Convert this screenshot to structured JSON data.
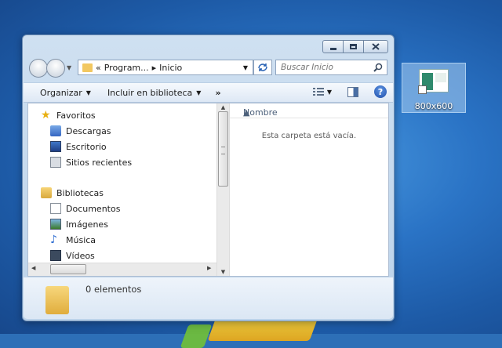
{
  "desktop_icon": {
    "label": "800x600"
  },
  "window": {
    "address": {
      "segments": [
        "«",
        "Program...",
        "▸",
        "Inicio"
      ]
    },
    "search": {
      "placeholder": "Buscar Inicio"
    },
    "toolbar": {
      "organize_label": "Organizar",
      "include_label": "Incluir en biblioteca",
      "more_label": "»"
    },
    "nav_pane": {
      "favorites": {
        "title": "Favoritos",
        "items": [
          "Descargas",
          "Escritorio",
          "Sitios recientes"
        ]
      },
      "libraries": {
        "title": "Bibliotecas",
        "items": [
          "Documentos",
          "Imágenes",
          "Música",
          "Vídeos"
        ]
      }
    },
    "content": {
      "column_name": "Nombre",
      "empty_message": "Esta carpeta está vacía."
    },
    "details": {
      "item_count": "0 elementos"
    },
    "help_label": "?"
  },
  "colors": {
    "accent": "#2a63b4",
    "window_frame": "#bcd3ea"
  }
}
